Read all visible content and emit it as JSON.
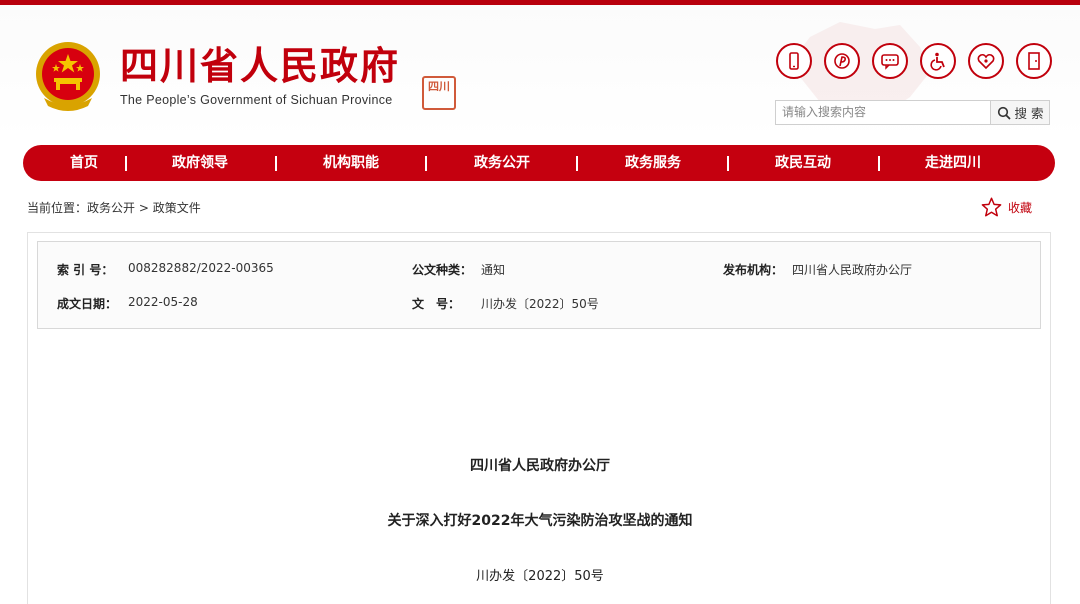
{
  "site": {
    "title": "四川省人民政府",
    "subtitle": "The People’s Government of Sichuan Province",
    "seal_text": "四川"
  },
  "header_icons": [
    {
      "name": "mobile-icon"
    },
    {
      "name": "weibo-icon"
    },
    {
      "name": "message-icon"
    },
    {
      "name": "accessibility-icon"
    },
    {
      "name": "elderly-care-icon"
    },
    {
      "name": "exit-icon"
    }
  ],
  "search": {
    "placeholder": "请输入搜索内容",
    "button_label": "搜 索"
  },
  "nav": {
    "items": [
      "首页",
      "政府领导",
      "机构职能",
      "政务公开",
      "政务服务",
      "政民互动",
      "走进四川"
    ]
  },
  "breadcrumb": {
    "prefix": "当前位置：",
    "items": [
      "政务公开",
      "政策文件"
    ],
    "separator": ">"
  },
  "favorite": {
    "label": "收藏"
  },
  "meta": {
    "index_label": "索 引 号：",
    "index_value": "008282882/2022-00365",
    "type_label": "公文种类：",
    "type_value": "通知",
    "publisher_label": "发布机构：",
    "publisher_value": "四川省人民政府办公厅",
    "date_label": "成文日期：",
    "date_value": "2022-05-28",
    "docno_label": "文　号：",
    "docno_value": "川办发〔2022〕50号"
  },
  "document": {
    "org": "四川省人民政府办公厅",
    "title": "关于深入打好2022年大气污染防治攻坚战的通知",
    "number": "川办发〔2022〕50号"
  },
  "colors": {
    "brand_red": "#c5000f",
    "top_bar": "#b8000d"
  }
}
